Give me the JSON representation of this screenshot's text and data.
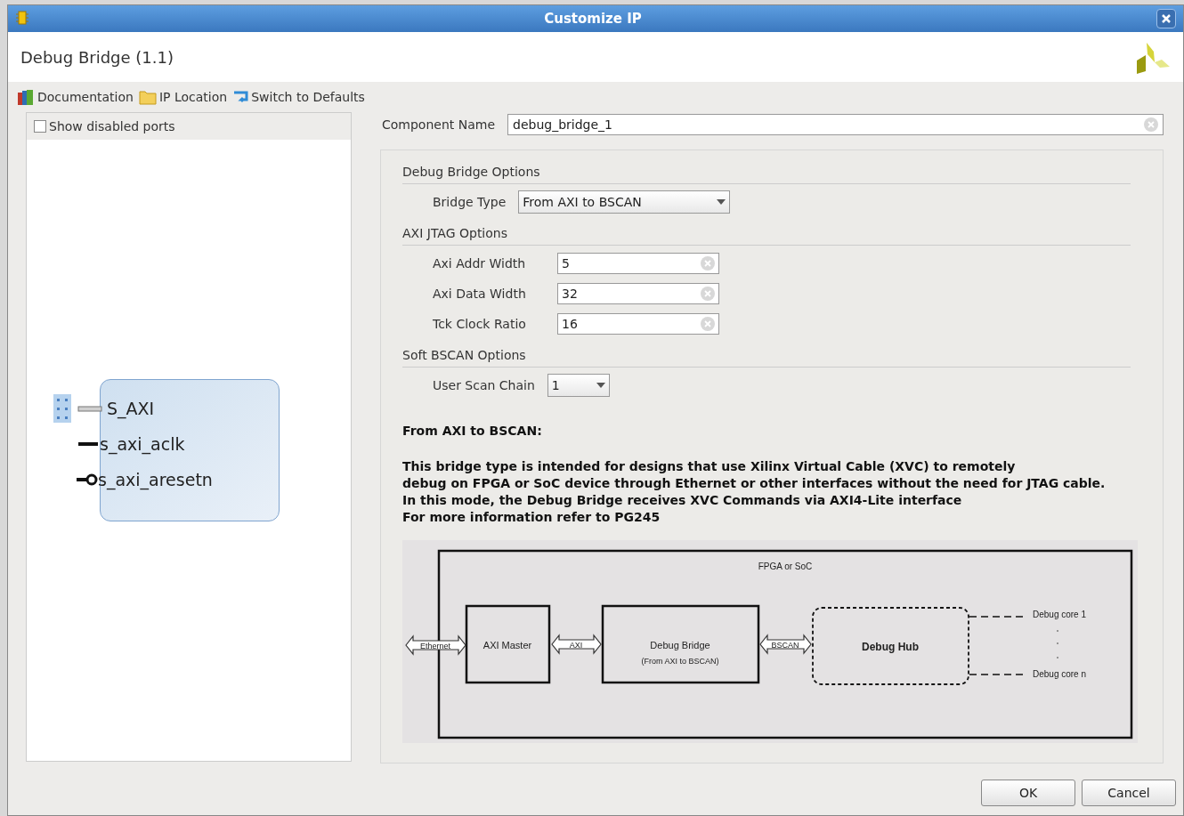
{
  "window": {
    "title": "Customize IP"
  },
  "header": {
    "title": "Debug Bridge (1.1)"
  },
  "toolbar": [
    {
      "kind": "docs",
      "label": "Documentation"
    },
    {
      "kind": "folder",
      "label": "IP Location"
    },
    {
      "kind": "refresh",
      "label": "Switch to Defaults"
    }
  ],
  "show_disabled_ports": {
    "label": "Show disabled ports",
    "checked": false
  },
  "symbol": {
    "ports": [
      {
        "kind": "bus",
        "name": "S_AXI"
      },
      {
        "kind": "clock",
        "name": "s_axi_aclk"
      },
      {
        "kind": "reset",
        "name": "s_axi_aresetn"
      }
    ]
  },
  "component_name": {
    "label": "Component Name",
    "value": "debug_bridge_1"
  },
  "sections": [
    {
      "title": "Debug Bridge Options",
      "fields": [
        {
          "kind": "dropdown",
          "label": "Bridge Type",
          "value": "From AXI to BSCAN"
        }
      ]
    },
    {
      "title": "AXI JTAG Options",
      "fields": [
        {
          "kind": "text",
          "label": "Axi Addr Width",
          "value": "5"
        },
        {
          "kind": "text",
          "label": "Axi Data Width",
          "value": "32"
        },
        {
          "kind": "text",
          "label": "Tck Clock Ratio",
          "value": "16"
        }
      ]
    },
    {
      "title": "Soft BSCAN Options",
      "fields": [
        {
          "kind": "dropdown",
          "label": "User Scan Chain",
          "value": "1"
        }
      ]
    }
  ],
  "description": {
    "heading": "From AXI to BSCAN:",
    "lines": [
      "This bridge type is intended for designs that use Xilinx Virtual Cable (XVC) to remotely",
      "debug on FPGA or SoC device through Ethernet or other interfaces without the need for JTAG cable.",
      "In this mode, the Debug Bridge receives XVC Commands via AXI4-Lite interface",
      "For more information refer to PG245"
    ]
  },
  "diagram": {
    "container": "FPGA or SoC",
    "ethernet": "Ethernet",
    "axi_master": "AXI Master",
    "axi": "AXI",
    "debug_bridge": "Debug Bridge",
    "debug_bridge_sub": "(From AXI to BSCAN)",
    "bscan": "BSCAN",
    "debug_hub": "Debug Hub",
    "core_first": "Debug core 1",
    "core_last": "Debug core n"
  },
  "buttons": [
    "OK",
    "Cancel"
  ]
}
